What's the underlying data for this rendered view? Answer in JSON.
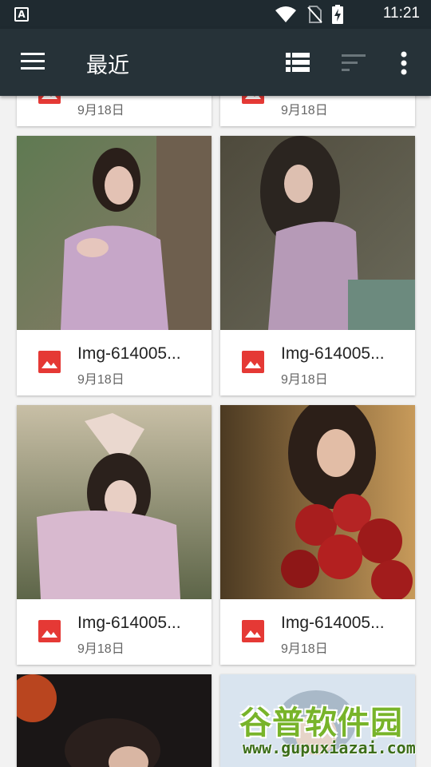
{
  "status_bar": {
    "time": "11:21",
    "icons": [
      "app-notification-icon",
      "wifi-icon",
      "no-sim-icon",
      "battery-charging-icon"
    ],
    "notification_glyph": "A"
  },
  "toolbar": {
    "title": "最近",
    "actions": [
      "menu-icon",
      "list-view-icon",
      "sort-icon",
      "more-options-icon"
    ]
  },
  "files": [
    {
      "name": "",
      "date": "9月18日"
    },
    {
      "name": "",
      "date": "9月18日"
    },
    {
      "name": "Img-614005...",
      "date": "9月18日"
    },
    {
      "name": "Img-614005...",
      "date": "9月18日"
    },
    {
      "name": "Img-614005...",
      "date": "9月18日"
    },
    {
      "name": "Img-614005...",
      "date": "9月18日"
    },
    {
      "name": "",
      "date": ""
    },
    {
      "name": "",
      "date": ""
    }
  ],
  "watermark": {
    "brand": "谷普软件园",
    "url": "www.gupuxiazai.com"
  },
  "colors": {
    "toolbar": "#263238",
    "status_bar": "#1f2a30",
    "image_icon": "#e53935",
    "background": "#f2f2f2",
    "watermark_green": "#78b42a"
  }
}
